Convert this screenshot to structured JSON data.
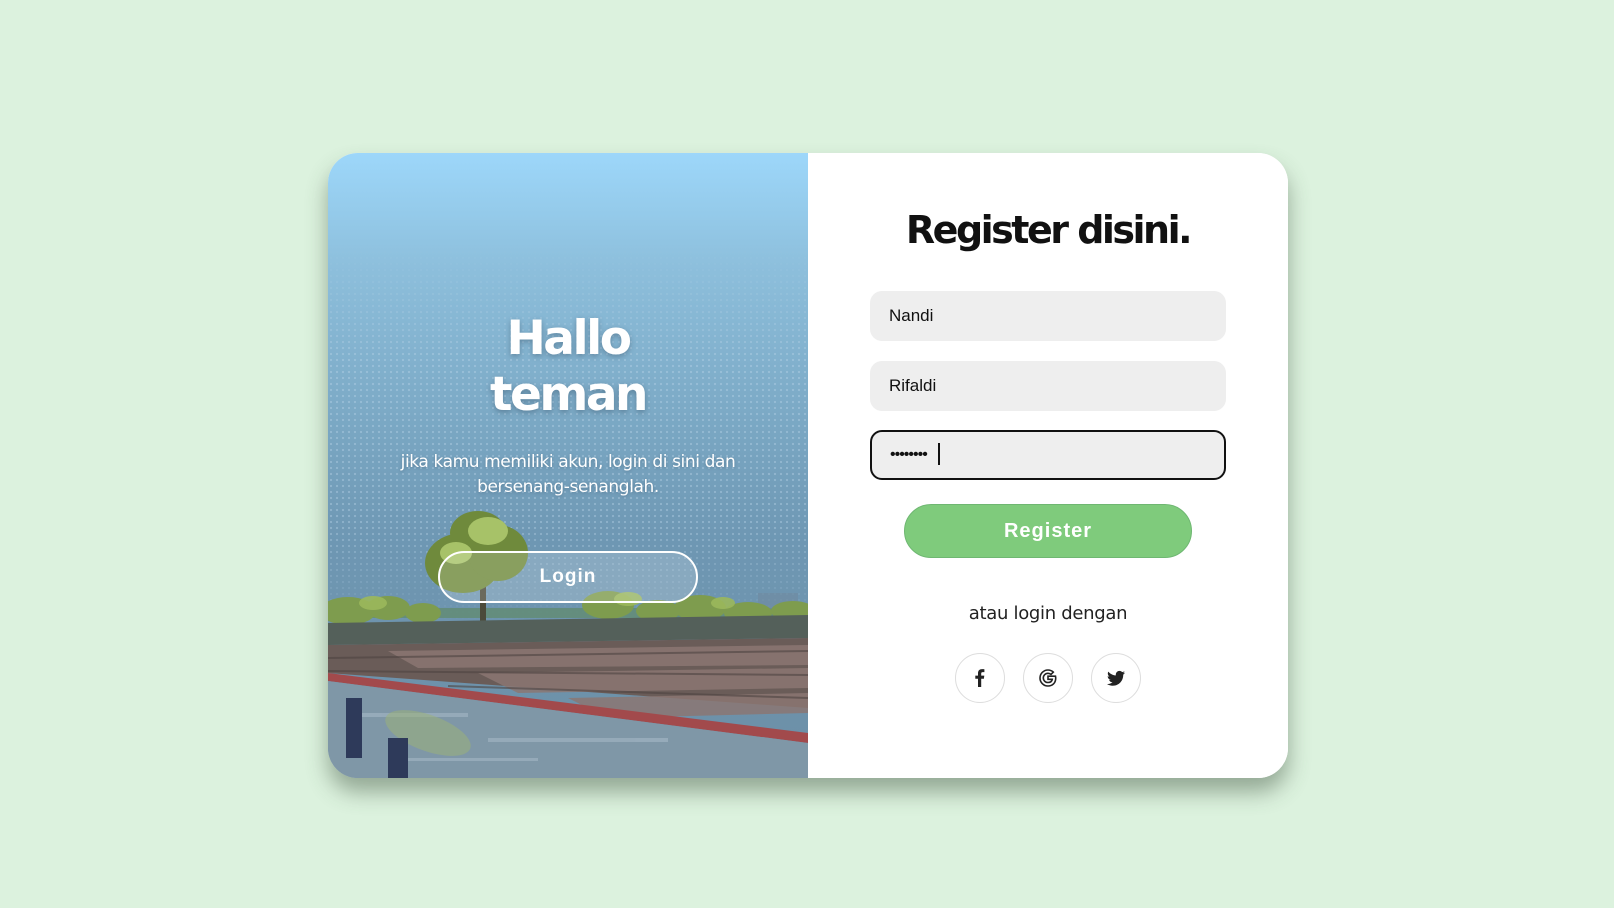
{
  "theme": {
    "page_background": "#dcf2de",
    "accent_green": "#7fcb7c",
    "field_background": "#eeeeee"
  },
  "left_panel": {
    "title_line1": "Hallo",
    "title_line2": "teman",
    "subtitle": "jika kamu memiliki akun, login di sini dan bersenang-senanglah.",
    "login_button": "Login",
    "background_icon": "pixel-art-river-landscape"
  },
  "register_form": {
    "title": "Register disini.",
    "first_name_value": "Nandi",
    "last_name_value": "Rifaldi",
    "password_value": "••••••••",
    "register_button": "Register",
    "alt_login_text": "atau login dengan",
    "social_icons": [
      "facebook-icon",
      "google-icon",
      "twitter-icon"
    ]
  }
}
